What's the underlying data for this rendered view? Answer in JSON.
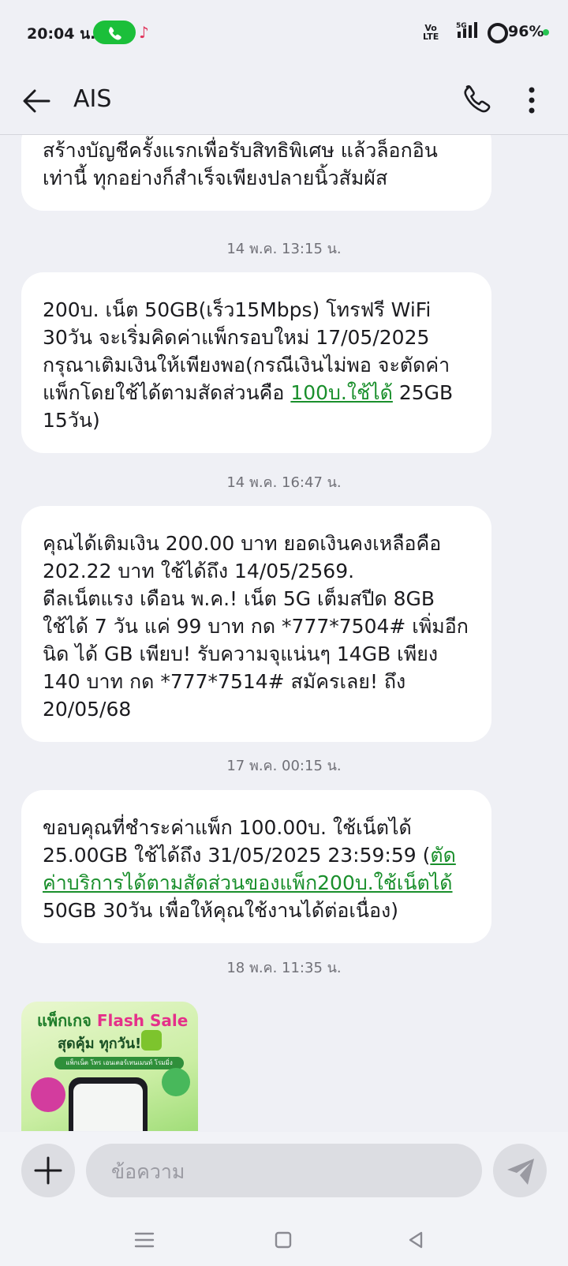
{
  "status_bar": {
    "time": "20:04 น.",
    "volte_line1": "Vo",
    "volte_line2": "LTE",
    "network": "5G",
    "battery": "96%"
  },
  "header": {
    "title": "AIS"
  },
  "messages": [
    {
      "id": "msg-0",
      "text": "สร้างบัญชีครั้งแรกเพื่อรับสิทธิพิเศษ แล้วล็อกอิน เท่านี้ ทุกอย่างก็สำเร็จเพียงปลายนิ้วสัมผัส"
    },
    {
      "id": "msg-1",
      "timestamp": "14 พ.ค. 13:15 น.",
      "text_before": "200บ. เน็ต 50GB(เร็ว15Mbps) โทรฟรี WiFi 30วัน จะเริ่มคิดค่าแพ็กรอบใหม่ 17/05/2025 กรุณาเติมเงินให้เพียงพอ(กรณีเงินไม่พอ จะตัดค่าแพ็กโดยใช้ได้ตามสัดส่วนคือ ",
      "link": "100บ.ใช้ได้",
      "text_after": " 25GB 15วัน)"
    },
    {
      "id": "msg-2",
      "timestamp": "14 พ.ค. 16:47 น.",
      "text": "คุณได้เติมเงิน 200.00 บาท ยอดเงินคงเหลือคือ 202.22 บาท ใช้ได้ถึง 14/05/2569.",
      "text2": "ดีลเน็ตแรง เดือน พ.ค.! เน็ต 5G เต็มสปีด 8GB ใช้ได้  7 วัน แค่ 99 บาท กด *777*7504# เพิ่มอีกนิด ได้ GB เพียบ! รับความจุแน่นๆ 14GB เพียง 140 บาท กด *777*7514# สมัครเลย! ถึง 20/05/68"
    },
    {
      "id": "msg-3",
      "timestamp": "17 พ.ค. 00:15 น.",
      "text_before": "ขอบคุณที่ชำระค่าแพ็ก 100.00บ. ใช้เน็ตได้ 25.00GB ใช้ได้ถึง 31/05/2025 23:59:59 (",
      "link": "ตัดค่าบริการได้ตามสัดส่วนของแพ็ก200บ.ใช้เน็ตได้",
      "text_after": " 50GB 30วัน เพื่อให้คุณใช้งานได้ต่อเนื่อง)"
    },
    {
      "id": "msg-4",
      "timestamp": "18 พ.ค. 11:35 น.",
      "image": {
        "headline_a": "แพ็กเกจ",
        "headline_b": "Flash Sale",
        "subhead": "สุดคุ้ม ทุกวัน!",
        "strip": "แพ็กเน็ต โทร เอนเตอร์เทนเมนท์ โรมมิ่ง"
      }
    }
  ],
  "composer": {
    "placeholder": "ข้อความ"
  },
  "colors": {
    "background": "#eff0f5",
    "bubble": "#ffffff",
    "link": "#1a8f2c",
    "call_pill": "#1bbf3a"
  }
}
